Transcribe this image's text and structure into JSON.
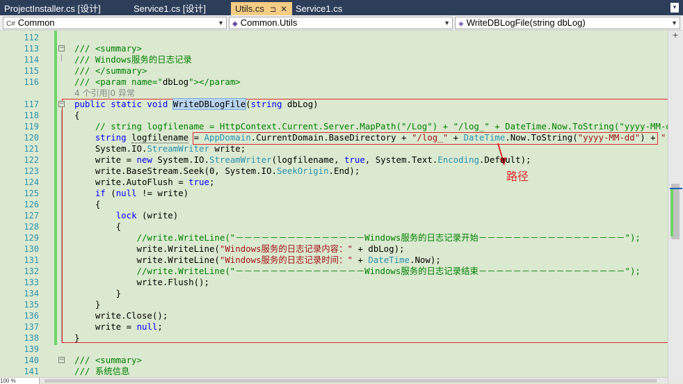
{
  "tabs": [
    {
      "label": "ProjectInstaller.cs [设计]",
      "active": false
    },
    {
      "label": "Service1.cs [设计]",
      "active": false
    },
    {
      "label": "Utils.cs",
      "active": true,
      "pin": "⊐",
      "close": "✕"
    },
    {
      "label": "Service1.cs",
      "active": false
    }
  ],
  "tab_overflow_icon": "▾",
  "navbar": {
    "project": {
      "icon": "C#",
      "label": "Common"
    },
    "type": {
      "icon": "◆",
      "label": "Common.Utils"
    },
    "member": {
      "icon": "◈",
      "label": "WriteDBLogFile(string dbLog)"
    }
  },
  "codelens": "4 个引用|0 异常",
  "annotation": "路径",
  "zoom_label": "100 %",
  "lines": [
    {
      "n": "112",
      "tokens": []
    },
    {
      "n": "113",
      "tokens": [
        {
          "t": "/// <summary>",
          "c": "cm"
        }
      ]
    },
    {
      "n": "114",
      "tokens": [
        {
          "t": "/// Windows服务的日志记录",
          "c": "cm"
        }
      ]
    },
    {
      "n": "115",
      "tokens": [
        {
          "t": "/// </summary>",
          "c": "cm"
        }
      ]
    },
    {
      "n": "116",
      "tokens": [
        {
          "t": "/// <param name=\"",
          "c": "cm"
        },
        {
          "t": "dbLog",
          "c": ""
        },
        {
          "t": "\"></param>",
          "c": "cm"
        }
      ]
    },
    {
      "n": "117",
      "tokens": [
        {
          "t": "public static void ",
          "c": "kw"
        },
        {
          "t": "WriteDBLogFile",
          "c": "hl"
        },
        {
          "t": "(",
          "c": ""
        },
        {
          "t": "string",
          "c": "kw"
        },
        {
          "t": " dbLog)",
          "c": ""
        }
      ]
    },
    {
      "n": "118",
      "tokens": [
        {
          "t": "{",
          "c": ""
        }
      ]
    },
    {
      "n": "119",
      "tokens": [
        {
          "t": "    // string logfilename = HttpContext.Current.Server.MapPath(\"/Log\") + \"/log_\" + DateTime.Now.ToString(\"yyyy-MM-dd\") + \"",
          "c": "cm"
        }
      ]
    },
    {
      "n": "120",
      "tokens": [
        {
          "t": "    ",
          "c": ""
        },
        {
          "t": "string",
          "c": "kw"
        },
        {
          "t": " ",
          "c": ""
        },
        {
          "t": "logfilename",
          "c": "dotted"
        },
        {
          "t": " = ",
          "c": ""
        },
        {
          "t": "AppDomain",
          "c": "ty"
        },
        {
          "t": ".CurrentDomain.BaseDirectory + ",
          "c": ""
        },
        {
          "t": "\"/log_\"",
          "c": "st"
        },
        {
          "t": " + ",
          "c": ""
        },
        {
          "t": "DateTime",
          "c": "ty"
        },
        {
          "t": ".Now.ToString(",
          "c": ""
        },
        {
          "t": "\"yyyy-MM-dd\"",
          "c": "st"
        },
        {
          "t": ") + ",
          "c": ""
        },
        {
          "t": "\".txt\"",
          "c": "st"
        },
        {
          "t": ";",
          "c": ""
        }
      ]
    },
    {
      "n": "121",
      "tokens": [
        {
          "t": "    System.IO.",
          "c": ""
        },
        {
          "t": "StreamWriter",
          "c": "ty"
        },
        {
          "t": " write;",
          "c": ""
        }
      ]
    },
    {
      "n": "122",
      "tokens": [
        {
          "t": "    write = ",
          "c": ""
        },
        {
          "t": "new",
          "c": "kw"
        },
        {
          "t": " System.IO.",
          "c": ""
        },
        {
          "t": "StreamWriter",
          "c": "ty"
        },
        {
          "t": "(logfilename, ",
          "c": ""
        },
        {
          "t": "true",
          "c": "kw"
        },
        {
          "t": ", System.Text.",
          "c": ""
        },
        {
          "t": "Encoding",
          "c": "ty"
        },
        {
          "t": ".Default);",
          "c": ""
        }
      ]
    },
    {
      "n": "123",
      "tokens": [
        {
          "t": "    write.BaseStream.Seek(0, System.IO.",
          "c": ""
        },
        {
          "t": "SeekOrigin",
          "c": "ty"
        },
        {
          "t": ".End);",
          "c": ""
        }
      ]
    },
    {
      "n": "124",
      "tokens": [
        {
          "t": "    write.AutoFlush = ",
          "c": ""
        },
        {
          "t": "true",
          "c": "kw"
        },
        {
          "t": ";",
          "c": ""
        }
      ]
    },
    {
      "n": "125",
      "tokens": [
        {
          "t": "    ",
          "c": ""
        },
        {
          "t": "if",
          "c": "kw"
        },
        {
          "t": " (",
          "c": ""
        },
        {
          "t": "null",
          "c": "kw"
        },
        {
          "t": " != write)",
          "c": ""
        }
      ]
    },
    {
      "n": "126",
      "tokens": [
        {
          "t": "    {",
          "c": ""
        }
      ]
    },
    {
      "n": "127",
      "tokens": [
        {
          "t": "        ",
          "c": ""
        },
        {
          "t": "lock",
          "c": "kw"
        },
        {
          "t": " (write)",
          "c": ""
        }
      ]
    },
    {
      "n": "128",
      "tokens": [
        {
          "t": "        {",
          "c": ""
        }
      ]
    },
    {
      "n": "129",
      "tokens": [
        {
          "t": "            //write.WriteLine(\"－－－－－－－－－－－－－－－Windows服务的日志记录开始－－－－－－－－－－－－－－－－－\");",
          "c": "cm"
        }
      ]
    },
    {
      "n": "130",
      "tokens": [
        {
          "t": "            write.WriteLine(",
          "c": ""
        },
        {
          "t": "\"Windows服务的日志记录内容：\"",
          "c": "st"
        },
        {
          "t": " + dbLog);",
          "c": ""
        }
      ]
    },
    {
      "n": "131",
      "tokens": [
        {
          "t": "            write.WriteLine(",
          "c": ""
        },
        {
          "t": "\"Windows服务的日志记录时间：\"",
          "c": "st"
        },
        {
          "t": " + ",
          "c": ""
        },
        {
          "t": "DateTime",
          "c": "ty"
        },
        {
          "t": ".Now);",
          "c": ""
        }
      ]
    },
    {
      "n": "132",
      "tokens": [
        {
          "t": "            //write.WriteLine(\"－－－－－－－－－－－－－－－Windows服务的日志记录结束－－－－－－－－－－－－－－－－－\");",
          "c": "cm"
        }
      ]
    },
    {
      "n": "133",
      "tokens": [
        {
          "t": "            write.Flush();",
          "c": ""
        }
      ]
    },
    {
      "n": "134",
      "tokens": [
        {
          "t": "        }",
          "c": ""
        }
      ]
    },
    {
      "n": "135",
      "tokens": [
        {
          "t": "    }",
          "c": ""
        }
      ]
    },
    {
      "n": "136",
      "tokens": [
        {
          "t": "    write.Close();",
          "c": ""
        }
      ]
    },
    {
      "n": "137",
      "tokens": [
        {
          "t": "    write = ",
          "c": ""
        },
        {
          "t": "null",
          "c": "kw"
        },
        {
          "t": ";",
          "c": ""
        }
      ]
    },
    {
      "n": "138",
      "tokens": [
        {
          "t": "}",
          "c": ""
        }
      ]
    },
    {
      "n": "139",
      "tokens": []
    },
    {
      "n": "140",
      "tokens": [
        {
          "t": "/// <summary>",
          "c": "cm"
        }
      ]
    },
    {
      "n": "141",
      "tokens": [
        {
          "t": "/// 系统信息",
          "c": "cm"
        }
      ]
    }
  ],
  "colors": {
    "editor_bg": "#dbe9d0",
    "keyword": "#0000ff",
    "type": "#2b91af",
    "comment": "#008000",
    "string": "#a31515",
    "annotation": "#e0282c",
    "tab_active": "#f5cc84",
    "tab_strip": "#2d3e5a"
  }
}
